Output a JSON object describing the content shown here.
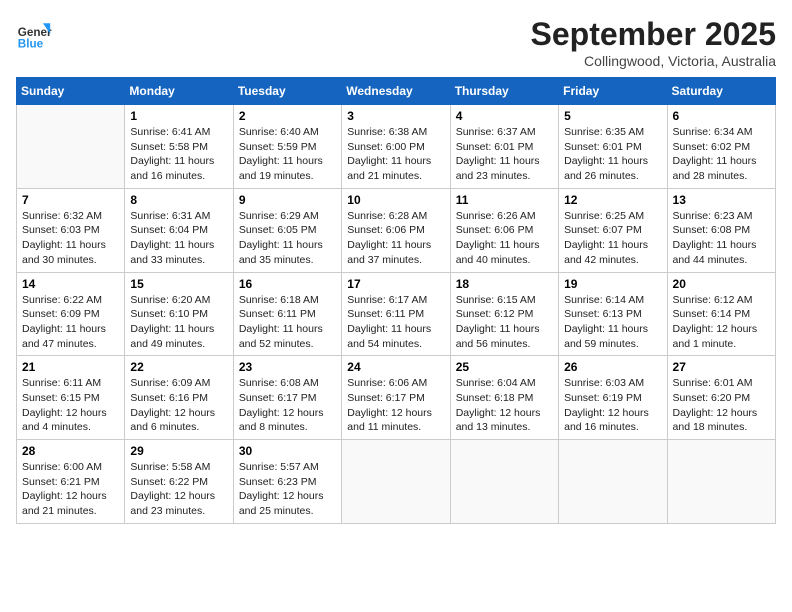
{
  "logo": {
    "general": "General",
    "blue": "Blue"
  },
  "title": "September 2025",
  "subtitle": "Collingwood, Victoria, Australia",
  "days_of_week": [
    "Sunday",
    "Monday",
    "Tuesday",
    "Wednesday",
    "Thursday",
    "Friday",
    "Saturday"
  ],
  "weeks": [
    [
      {
        "day": "",
        "text": ""
      },
      {
        "day": "1",
        "text": "Sunrise: 6:41 AM\nSunset: 5:58 PM\nDaylight: 11 hours and 16 minutes."
      },
      {
        "day": "2",
        "text": "Sunrise: 6:40 AM\nSunset: 5:59 PM\nDaylight: 11 hours and 19 minutes."
      },
      {
        "day": "3",
        "text": "Sunrise: 6:38 AM\nSunset: 6:00 PM\nDaylight: 11 hours and 21 minutes."
      },
      {
        "day": "4",
        "text": "Sunrise: 6:37 AM\nSunset: 6:01 PM\nDaylight: 11 hours and 23 minutes."
      },
      {
        "day": "5",
        "text": "Sunrise: 6:35 AM\nSunset: 6:01 PM\nDaylight: 11 hours and 26 minutes."
      },
      {
        "day": "6",
        "text": "Sunrise: 6:34 AM\nSunset: 6:02 PM\nDaylight: 11 hours and 28 minutes."
      }
    ],
    [
      {
        "day": "7",
        "text": "Sunrise: 6:32 AM\nSunset: 6:03 PM\nDaylight: 11 hours and 30 minutes."
      },
      {
        "day": "8",
        "text": "Sunrise: 6:31 AM\nSunset: 6:04 PM\nDaylight: 11 hours and 33 minutes."
      },
      {
        "day": "9",
        "text": "Sunrise: 6:29 AM\nSunset: 6:05 PM\nDaylight: 11 hours and 35 minutes."
      },
      {
        "day": "10",
        "text": "Sunrise: 6:28 AM\nSunset: 6:06 PM\nDaylight: 11 hours and 37 minutes."
      },
      {
        "day": "11",
        "text": "Sunrise: 6:26 AM\nSunset: 6:06 PM\nDaylight: 11 hours and 40 minutes."
      },
      {
        "day": "12",
        "text": "Sunrise: 6:25 AM\nSunset: 6:07 PM\nDaylight: 11 hours and 42 minutes."
      },
      {
        "day": "13",
        "text": "Sunrise: 6:23 AM\nSunset: 6:08 PM\nDaylight: 11 hours and 44 minutes."
      }
    ],
    [
      {
        "day": "14",
        "text": "Sunrise: 6:22 AM\nSunset: 6:09 PM\nDaylight: 11 hours and 47 minutes."
      },
      {
        "day": "15",
        "text": "Sunrise: 6:20 AM\nSunset: 6:10 PM\nDaylight: 11 hours and 49 minutes."
      },
      {
        "day": "16",
        "text": "Sunrise: 6:18 AM\nSunset: 6:11 PM\nDaylight: 11 hours and 52 minutes."
      },
      {
        "day": "17",
        "text": "Sunrise: 6:17 AM\nSunset: 6:11 PM\nDaylight: 11 hours and 54 minutes."
      },
      {
        "day": "18",
        "text": "Sunrise: 6:15 AM\nSunset: 6:12 PM\nDaylight: 11 hours and 56 minutes."
      },
      {
        "day": "19",
        "text": "Sunrise: 6:14 AM\nSunset: 6:13 PM\nDaylight: 11 hours and 59 minutes."
      },
      {
        "day": "20",
        "text": "Sunrise: 6:12 AM\nSunset: 6:14 PM\nDaylight: 12 hours and 1 minute."
      }
    ],
    [
      {
        "day": "21",
        "text": "Sunrise: 6:11 AM\nSunset: 6:15 PM\nDaylight: 12 hours and 4 minutes."
      },
      {
        "day": "22",
        "text": "Sunrise: 6:09 AM\nSunset: 6:16 PM\nDaylight: 12 hours and 6 minutes."
      },
      {
        "day": "23",
        "text": "Sunrise: 6:08 AM\nSunset: 6:17 PM\nDaylight: 12 hours and 8 minutes."
      },
      {
        "day": "24",
        "text": "Sunrise: 6:06 AM\nSunset: 6:17 PM\nDaylight: 12 hours and 11 minutes."
      },
      {
        "day": "25",
        "text": "Sunrise: 6:04 AM\nSunset: 6:18 PM\nDaylight: 12 hours and 13 minutes."
      },
      {
        "day": "26",
        "text": "Sunrise: 6:03 AM\nSunset: 6:19 PM\nDaylight: 12 hours and 16 minutes."
      },
      {
        "day": "27",
        "text": "Sunrise: 6:01 AM\nSunset: 6:20 PM\nDaylight: 12 hours and 18 minutes."
      }
    ],
    [
      {
        "day": "28",
        "text": "Sunrise: 6:00 AM\nSunset: 6:21 PM\nDaylight: 12 hours and 21 minutes."
      },
      {
        "day": "29",
        "text": "Sunrise: 5:58 AM\nSunset: 6:22 PM\nDaylight: 12 hours and 23 minutes."
      },
      {
        "day": "30",
        "text": "Sunrise: 5:57 AM\nSunset: 6:23 PM\nDaylight: 12 hours and 25 minutes."
      },
      {
        "day": "",
        "text": ""
      },
      {
        "day": "",
        "text": ""
      },
      {
        "day": "",
        "text": ""
      },
      {
        "day": "",
        "text": ""
      }
    ]
  ]
}
